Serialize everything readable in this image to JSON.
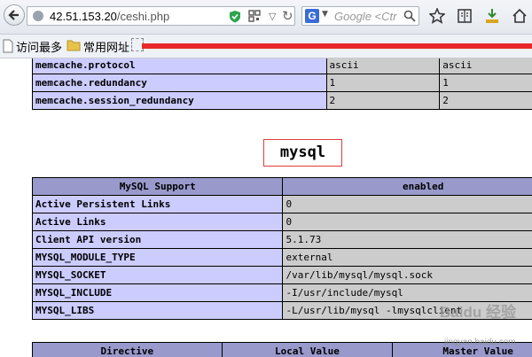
{
  "browser": {
    "url_host": "42.51.153.20",
    "url_path": "/ceshi.php",
    "search_engine_icon": "G",
    "search_placeholder": "Google <Ctr"
  },
  "bookmarks": [
    {
      "label": "访问最多"
    },
    {
      "label": "常用网址"
    }
  ],
  "memcache_rows": [
    {
      "directive": "memcache.protocol",
      "local": "ascii",
      "master": "ascii"
    },
    {
      "directive": "memcache.redundancy",
      "local": "1",
      "master": "1"
    },
    {
      "directive": "memcache.session_redundancy",
      "local": "2",
      "master": "2"
    }
  ],
  "mysql": {
    "title": "mysql",
    "support_header": [
      "MySQL Support",
      "enabled"
    ],
    "rows": [
      {
        "key": "Active Persistent Links",
        "value": "0"
      },
      {
        "key": "Active Links",
        "value": "0"
      },
      {
        "key": "Client API version",
        "value": "5.1.73"
      },
      {
        "key": "MYSQL_MODULE_TYPE",
        "value": "external"
      },
      {
        "key": "MYSQL_SOCKET",
        "value": "/var/lib/mysql/mysql.sock"
      },
      {
        "key": "MYSQL_INCLUDE",
        "value": "-I/usr/include/mysql"
      },
      {
        "key": "MYSQL_LIBS",
        "value": "-L/usr/lib/mysql -lmysqlclient"
      }
    ],
    "directive_header": [
      "Directive",
      "Local Value",
      "Master Value"
    ]
  },
  "watermark": {
    "text": "Baidu 经验",
    "sub": "jingyan.baidu.com"
  }
}
